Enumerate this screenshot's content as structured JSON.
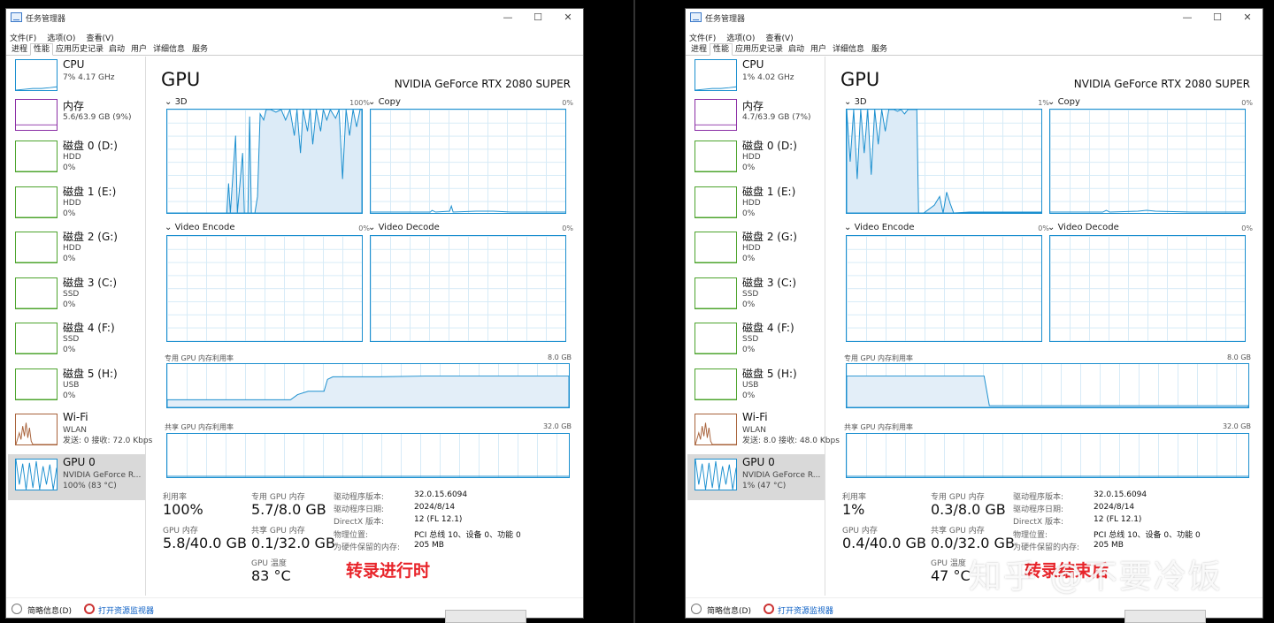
{
  "windows": [
    {
      "title": "任务管理器",
      "menu": [
        "文件(F)",
        "选项(O)",
        "查看(V)"
      ],
      "tabs": [
        "进程",
        "性能",
        "应用历史记录",
        "启动",
        "用户",
        "详细信息",
        "服务"
      ],
      "active_tab": "性能",
      "sidebar": [
        {
          "name": "CPU",
          "sub1": "7% 4.17 GHz",
          "sub2": "",
          "color": "#1b8fcf",
          "icon": "cpu-graph"
        },
        {
          "name": "内存",
          "sub1": "5.6/63.9 GB (9%)",
          "sub2": "",
          "color": "#8b2ea5",
          "icon": "memory-graph"
        },
        {
          "name": "磁盘 0 (D:)",
          "sub1": "HDD",
          "sub2": "0%",
          "color": "#4da42d",
          "icon": "disk-graph"
        },
        {
          "name": "磁盘 1 (E:)",
          "sub1": "HDD",
          "sub2": "0%",
          "color": "#4da42d",
          "icon": "disk-graph"
        },
        {
          "name": "磁盘 2 (G:)",
          "sub1": "HDD",
          "sub2": "0%",
          "color": "#4da42d",
          "icon": "disk-graph"
        },
        {
          "name": "磁盘 3 (C:)",
          "sub1": "SSD",
          "sub2": "0%",
          "color": "#4da42d",
          "icon": "disk-graph"
        },
        {
          "name": "磁盘 4 (F:)",
          "sub1": "SSD",
          "sub2": "0%",
          "color": "#4da42d",
          "icon": "disk-graph"
        },
        {
          "name": "磁盘 5 (H:)",
          "sub1": "USB",
          "sub2": "0%",
          "color": "#4da42d",
          "icon": "disk-graph"
        },
        {
          "name": "Wi-Fi",
          "sub1": "WLAN",
          "sub2": "发送: 0 接收: 72.0 Kbps",
          "color": "#a8623a",
          "icon": "network-graph"
        },
        {
          "name": "GPU 0",
          "sub1": "NVIDIA GeForce R...",
          "sub2": "100% (83 °C)",
          "color": "#1b8fcf",
          "icon": "gpu-graph"
        }
      ],
      "gpu_title": "GPU",
      "gpu_model": "NVIDIA GeForce RTX 2080 SUPER",
      "engines": [
        {
          "name": "3D",
          "pct": "100%"
        },
        {
          "name": "Copy",
          "pct": "0%"
        },
        {
          "name": "Video Encode",
          "pct": "0%"
        },
        {
          "name": "Video Decode",
          "pct": "0%"
        }
      ],
      "dedicated_label": "专用 GPU 内存利用率",
      "dedicated_max": "8.0 GB",
      "shared_label": "共享 GPU 内存利用率",
      "shared_max": "32.0 GB",
      "stats": {
        "util_label": "利用率",
        "util_value": "100%",
        "ded_label": "专用 GPU 内存",
        "ded_value": "5.7/8.0 GB",
        "gpumem_label": "GPU 内存",
        "gpumem_value": "5.8/40.0 GB",
        "shared_label": "共享 GPU 内存",
        "shared_value": "0.1/32.0 GB",
        "temp_label": "GPU 温度",
        "temp_value": "83 °C"
      },
      "details": [
        {
          "k": "驱动程序版本:",
          "v": "32.0.15.6094"
        },
        {
          "k": "驱动程序日期:",
          "v": "2024/8/14"
        },
        {
          "k": "DirectX 版本:",
          "v": "12 (FL 12.1)"
        },
        {
          "k": "物理位置:",
          "v": "PCI 总线 10、设备 0、功能 0"
        },
        {
          "k": "为硬件保留的内存:",
          "v": "205 MB"
        }
      ],
      "footer_summary": "简略信息(D)",
      "footer_monitor": "打开资源监视器",
      "annotation": "转录进行时",
      "dedicated_level": 0.71
    },
    {
      "title": "任务管理器",
      "menu": [
        "文件(F)",
        "选项(O)",
        "查看(V)"
      ],
      "tabs": [
        "进程",
        "性能",
        "应用历史记录",
        "启动",
        "用户",
        "详细信息",
        "服务"
      ],
      "active_tab": "性能",
      "sidebar": [
        {
          "name": "CPU",
          "sub1": "1% 4.02 GHz",
          "sub2": "",
          "color": "#1b8fcf",
          "icon": "cpu-graph"
        },
        {
          "name": "内存",
          "sub1": "4.7/63.9 GB (7%)",
          "sub2": "",
          "color": "#8b2ea5",
          "icon": "memory-graph"
        },
        {
          "name": "磁盘 0 (D:)",
          "sub1": "HDD",
          "sub2": "0%",
          "color": "#4da42d",
          "icon": "disk-graph"
        },
        {
          "name": "磁盘 1 (E:)",
          "sub1": "HDD",
          "sub2": "0%",
          "color": "#4da42d",
          "icon": "disk-graph"
        },
        {
          "name": "磁盘 2 (G:)",
          "sub1": "HDD",
          "sub2": "0%",
          "color": "#4da42d",
          "icon": "disk-graph"
        },
        {
          "name": "磁盘 3 (C:)",
          "sub1": "SSD",
          "sub2": "0%",
          "color": "#4da42d",
          "icon": "disk-graph"
        },
        {
          "name": "磁盘 4 (F:)",
          "sub1": "SSD",
          "sub2": "0%",
          "color": "#4da42d",
          "icon": "disk-graph"
        },
        {
          "name": "磁盘 5 (H:)",
          "sub1": "USB",
          "sub2": "0%",
          "color": "#4da42d",
          "icon": "disk-graph"
        },
        {
          "name": "Wi-Fi",
          "sub1": "WLAN",
          "sub2": "发送: 8.0 接收: 48.0 Kbps",
          "color": "#a8623a",
          "icon": "network-graph"
        },
        {
          "name": "GPU 0",
          "sub1": "NVIDIA GeForce R...",
          "sub2": "1% (47 °C)",
          "color": "#1b8fcf",
          "icon": "gpu-graph"
        }
      ],
      "gpu_title": "GPU",
      "gpu_model": "NVIDIA GeForce RTX 2080 SUPER",
      "engines": [
        {
          "name": "3D",
          "pct": "1%"
        },
        {
          "name": "Copy",
          "pct": "0%"
        },
        {
          "name": "Video Encode",
          "pct": "0%"
        },
        {
          "name": "Video Decode",
          "pct": "0%"
        }
      ],
      "dedicated_label": "专用 GPU 内存利用率",
      "dedicated_max": "8.0 GB",
      "shared_label": "共享 GPU 内存利用率",
      "shared_max": "32.0 GB",
      "stats": {
        "util_label": "利用率",
        "util_value": "1%",
        "ded_label": "专用 GPU 内存",
        "ded_value": "0.3/8.0 GB",
        "gpumem_label": "GPU 内存",
        "gpumem_value": "0.4/40.0 GB",
        "shared_label": "共享 GPU 内存",
        "shared_value": "0.0/32.0 GB",
        "temp_label": "GPU 温度",
        "temp_value": "47 °C"
      },
      "details": [
        {
          "k": "驱动程序版本:",
          "v": "32.0.15.6094"
        },
        {
          "k": "驱动程序日期:",
          "v": "2024/8/14"
        },
        {
          "k": "DirectX 版本:",
          "v": "12 (FL 12.1)"
        },
        {
          "k": "物理位置:",
          "v": "PCI 总线 10、设备 0、功能 0"
        },
        {
          "k": "为硬件保留的内存:",
          "v": "205 MB"
        }
      ],
      "footer_summary": "简略信息(D)",
      "footer_monitor": "打开资源监视器",
      "annotation": "转录结束后",
      "dedicated_level": 0.04
    }
  ],
  "watermark": "知乎 @不要冷饭",
  "colors": {
    "gpu": "#1b8fcf",
    "memory": "#8b2ea5",
    "disk": "#4da42d",
    "network": "#a8623a",
    "annotation": "#e8242a"
  }
}
